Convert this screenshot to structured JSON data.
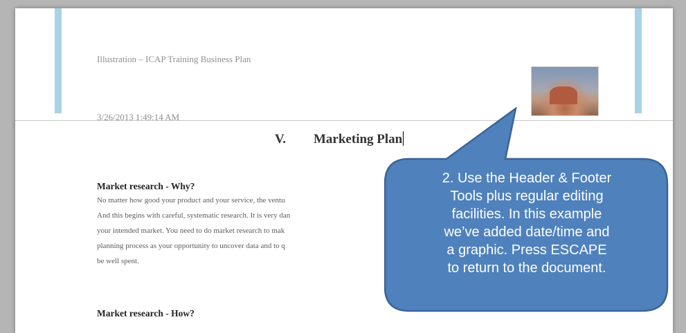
{
  "header": {
    "title": "Illustration – ICAP Training Business Plan",
    "date": "3/26/2013 1:49:14 AM",
    "image_icon": "landscape-photo"
  },
  "document": {
    "section_number": "V.",
    "section_title": "Marketing Plan",
    "subheading_why": "Market research - Why?",
    "body_lines": [
      "No matter how good your product and your service, the ventu",
      "And this begins with careful, systematic research. It is very dan",
      "your intended market. You need to do market research to mak",
      "planning process as your opportunity to uncover data and to q",
      "be well spent."
    ],
    "subheading_how": "Market research - How?"
  },
  "callout": {
    "lines": [
      "2. Use the Header & Footer",
      "Tools plus regular editing",
      "facilities. In this example",
      "we’ve added date/time and",
      "a graphic. Press ESCAPE",
      "to return to the document."
    ],
    "fill_color": "#4f81bd",
    "border_color": "#3a6496"
  },
  "colors": {
    "accent_bar": "#a9d3e6",
    "header_text": "#8e8e8e",
    "window_background": "#b5b5b5"
  }
}
